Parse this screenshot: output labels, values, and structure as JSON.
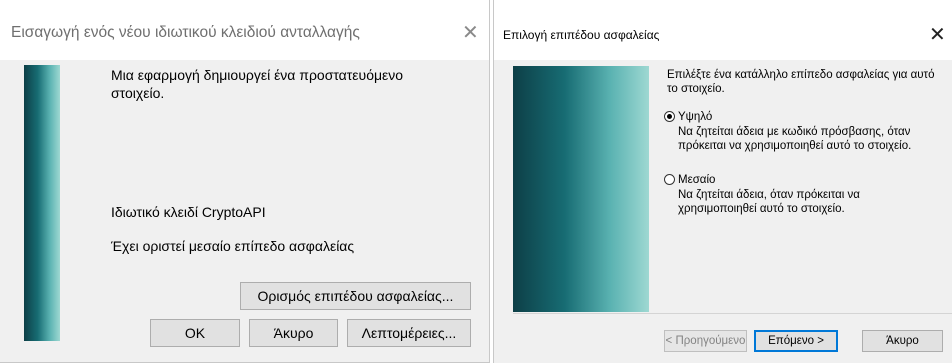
{
  "dialog1": {
    "title": "Εισαγωγή ενός νέου ιδιωτικού κλειδιού ανταλλαγής",
    "close_glyph": "✕",
    "message_line1": "Μια εφαρμογή δημιουργεί ένα προστατευόμενο",
    "message_line2": "στοιχείο.",
    "key_label": "Ιδιωτικό κλειδί CryptoAPI",
    "security_status": "Έχει οριστεί μεσαίο επίπεδο ασφαλείας",
    "set_security_button": "Ορισμός επιπέδου ασφαλείας...",
    "ok_button": "OK",
    "cancel_button": "Άκυρο",
    "details_button": "Λεπτομέρειες..."
  },
  "dialog2": {
    "title": "Επιλογή επιπέδου ασφαλείας",
    "close_glyph": "✕",
    "instruction_line1": "Επιλέξτε ένα κατάλληλο επίπεδο ασφαλείας για αυτό",
    "instruction_line2": "το στοιχείο.",
    "options": [
      {
        "label": "Υψηλό",
        "selected": true,
        "desc_line1": "Να ζητείται άδεια με κωδικό πρόσβασης, όταν",
        "desc_line2": "πρόκειται να χρησιμοποιηθεί αυτό το στοιχείο."
      },
      {
        "label": "Μεσαίο",
        "selected": false,
        "desc_line1": "Να ζητείται άδεια, όταν πρόκειται να",
        "desc_line2": "χρησιμοποιηθεί αυτό το στοιχείο."
      }
    ],
    "back_button": "< Προηγούμενο",
    "next_button": "Επόμενο >",
    "cancel_button": "Άκυρο"
  }
}
